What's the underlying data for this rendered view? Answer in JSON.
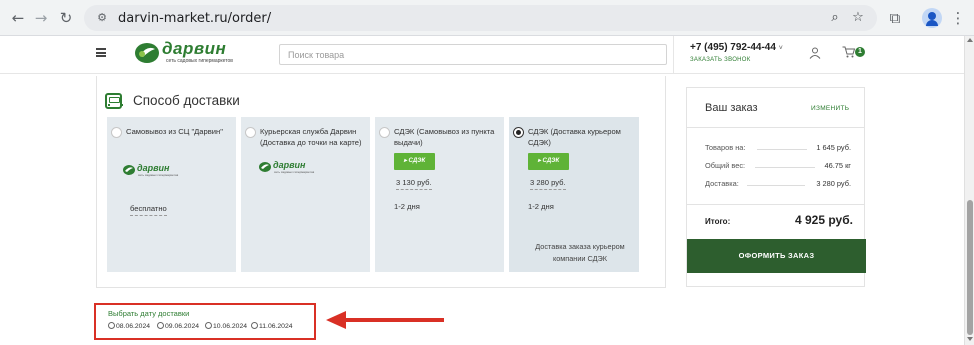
{
  "browser": {
    "url": "darvin-market.ru/order/",
    "icons": [
      "back-icon",
      "forward-icon",
      "reload-icon",
      "site-info-icon",
      "zoom-icon",
      "bookmark-star-icon",
      "extensions-icon",
      "profile-icon"
    ]
  },
  "header": {
    "logo_word": "дарвин",
    "logo_sub": "сеть садовых гипермаркетов",
    "search_placeholder": "Поиск товара",
    "phone": "+7 (495) 792-44-44",
    "phone_caret": "˅",
    "callback": "ЗАКАЗАТЬ ЗВОНОК",
    "cart_count": "1"
  },
  "delivery": {
    "title": "Способ доставки",
    "options": [
      {
        "label": "Самовывоз из СЦ \"Дарвин\"",
        "price": "бесплатно",
        "selected": false
      },
      {
        "label": "Курьерская служба Дарвин (Доставка до точки на карте)",
        "selected": false
      },
      {
        "label": "СДЭК (Самовывоз из пункта выдачи)",
        "badge": "СДЭК",
        "price": "3 130 руб.",
        "days": "1-2 дня",
        "selected": false
      },
      {
        "label": "СДЭК (Доставка курьером СДЭК)",
        "badge": "СДЭК",
        "price": "3 280 руб.",
        "days": "1-2 дня",
        "note": "Доставка заказа курьером компании СДЭК",
        "selected": true
      }
    ]
  },
  "order": {
    "title": "Ваш заказ",
    "edit": "ИЗМЕНИТЬ",
    "rows": [
      {
        "label": "Товаров на:",
        "value": "1 645 руб."
      },
      {
        "label": "Общий вес:",
        "value": "46.75 кг"
      },
      {
        "label": "Доставка:",
        "value": "3 280 руб."
      }
    ],
    "total_label": "Итого:",
    "total_value": "4 925 руб.",
    "checkout": "ОФОРМИТЬ ЗАКАЗ"
  },
  "delivery_date": {
    "title": "Выбрать дату доставки",
    "dates": [
      "08.06.2024",
      "09.06.2024",
      "10.06.2024",
      "11.06.2024"
    ]
  },
  "colors": {
    "brand_green": "#2e7d32",
    "cdek_green": "#5fb337",
    "checkout_bg": "#2d5e2e",
    "annotation_red": "#d93025"
  }
}
